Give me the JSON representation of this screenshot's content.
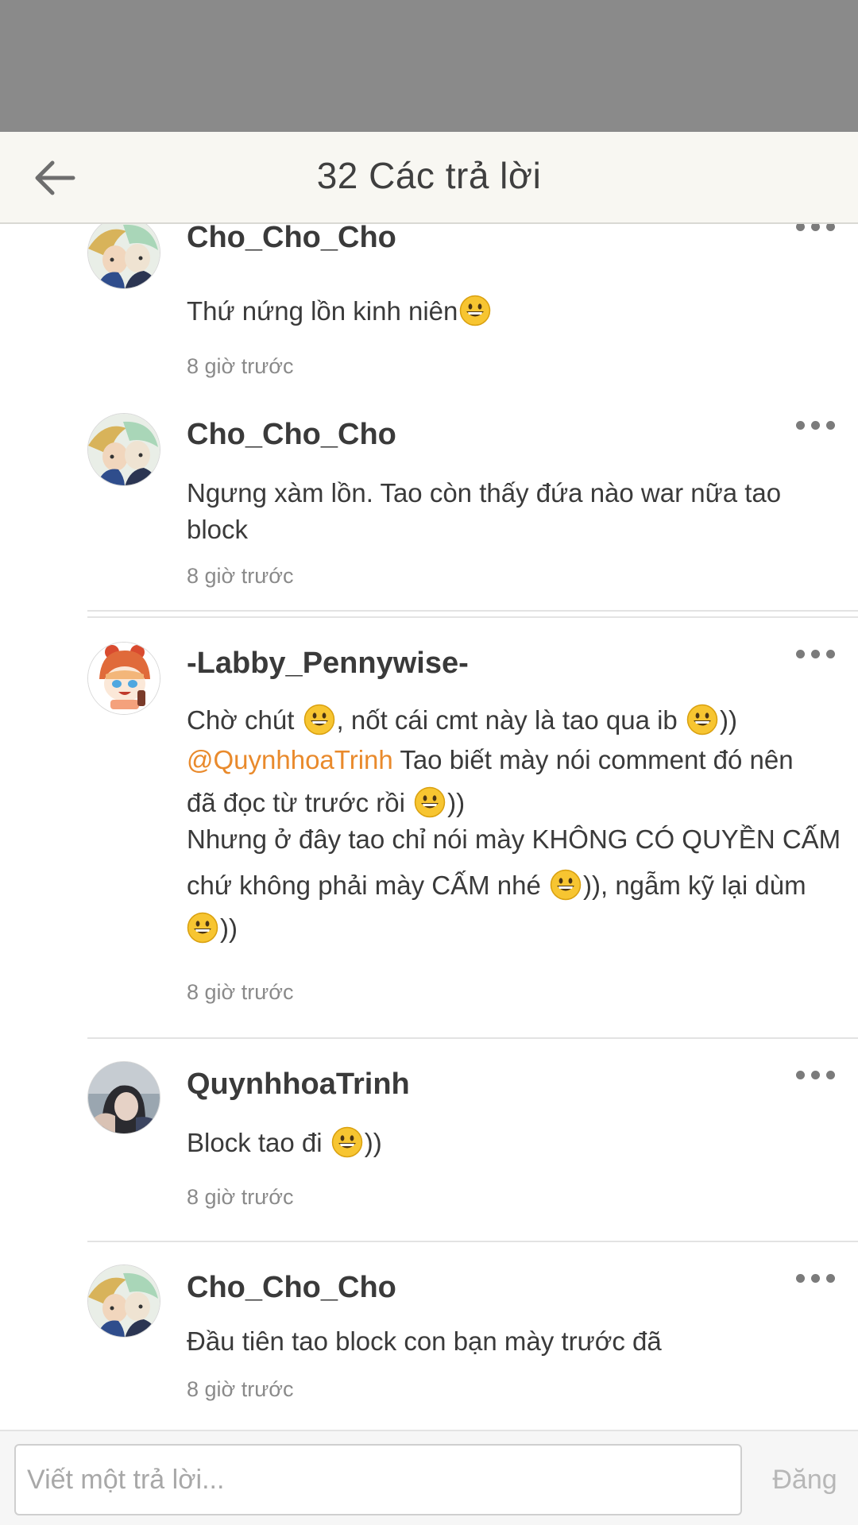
{
  "header": {
    "title": "32 Các trả lời"
  },
  "comments": [
    {
      "username": "Cho_Cho_Cho",
      "lines": [
        {
          "text": "Thứ nứng lồn kinh niên",
          "emoji_after": true
        }
      ],
      "time": "8 giờ trước"
    },
    {
      "username": "Cho_Cho_Cho",
      "lines": [
        {
          "text": "Ngưng xàm lồn. Tao còn thấy đứa nào war nữa tao"
        },
        {
          "text": "block"
        }
      ],
      "time": "8 giờ trước"
    },
    {
      "username": "-Labby_Pennywise-",
      "line1a": "Chờ chút ",
      "line1b": ", nốt cái cmt này là tao qua ib ",
      "line1c": "))",
      "mention": "@QuynhhoaTrinh",
      "line2": " Tao biết mày nói comment đó nên",
      "line3a": "đã đọc từ trước rồi ",
      "line3b": "))",
      "line4": "Nhưng ở đây tao chỉ nói mày KHÔNG CÓ QUYỀN CẤM",
      "line5a": "chứ không phải mày CẤM nhé ",
      "line5b": ")), ngẫm kỹ lại dùm",
      "line6": "))",
      "time": "8 giờ trước"
    },
    {
      "username": "QuynhhoaTrinh",
      "text_a": "Block tao đi ",
      "text_b": "))",
      "time": "8 giờ trước"
    },
    {
      "username": "Cho_Cho_Cho",
      "text": "Đầu tiên tao block con bạn mày trước đã",
      "time": "8 giờ trước"
    }
  ],
  "composer": {
    "placeholder": "Viết một trả lời...",
    "post_label": "Đăng"
  },
  "icons": {
    "back": "arrow-left-icon",
    "more": "more-dots-icon",
    "emoji": "grinning-face-emoji"
  },
  "colors": {
    "mention": "#e98a2c",
    "header_bg": "#f8f7f2",
    "status_bar": "#8a8a8a"
  }
}
